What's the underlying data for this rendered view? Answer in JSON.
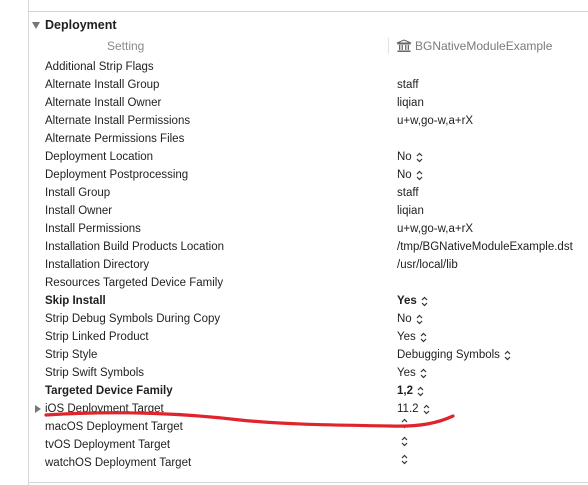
{
  "section": {
    "title": "Deployment"
  },
  "columns": {
    "setting": "Setting",
    "target": "BGNativeModuleExample"
  },
  "annotation": {
    "color": "#e0242c"
  },
  "rows": [
    {
      "name": "Additional Strip Flags",
      "value": "",
      "popup": false,
      "bold": false
    },
    {
      "name": "Alternate Install Group",
      "value": "staff",
      "popup": false,
      "bold": false
    },
    {
      "name": "Alternate Install Owner",
      "value": "liqian",
      "popup": false,
      "bold": false
    },
    {
      "name": "Alternate Install Permissions",
      "value": "u+w,go-w,a+rX",
      "popup": false,
      "bold": false
    },
    {
      "name": "Alternate Permissions Files",
      "value": "",
      "popup": false,
      "bold": false
    },
    {
      "name": "Deployment Location",
      "value": "No",
      "popup": true,
      "bold": false
    },
    {
      "name": "Deployment Postprocessing",
      "value": "No",
      "popup": true,
      "bold": false
    },
    {
      "name": "Install Group",
      "value": "staff",
      "popup": false,
      "bold": false
    },
    {
      "name": "Install Owner",
      "value": "liqian",
      "popup": false,
      "bold": false
    },
    {
      "name": "Install Permissions",
      "value": "u+w,go-w,a+rX",
      "popup": false,
      "bold": false
    },
    {
      "name": "Installation Build Products Location",
      "value": "/tmp/BGNativeModuleExample.dst",
      "popup": false,
      "bold": false
    },
    {
      "name": "Installation Directory",
      "value": "/usr/local/lib",
      "popup": false,
      "bold": false
    },
    {
      "name": "Resources Targeted Device Family",
      "value": "",
      "popup": false,
      "bold": false
    },
    {
      "name": "Skip Install",
      "value": "Yes",
      "popup": true,
      "bold": true
    },
    {
      "name": "Strip Debug Symbols During Copy",
      "value": "No",
      "popup": true,
      "bold": false
    },
    {
      "name": "Strip Linked Product",
      "value": "Yes",
      "popup": true,
      "bold": false
    },
    {
      "name": "Strip Style",
      "value": "Debugging Symbols",
      "popup": true,
      "bold": false
    },
    {
      "name": "Strip Swift Symbols",
      "value": "Yes",
      "popup": true,
      "bold": false
    },
    {
      "name": "Targeted Device Family",
      "value": "1,2",
      "popup": true,
      "bold": true
    },
    {
      "name": "iOS Deployment Target",
      "value": "11.2",
      "popup": true,
      "bold": false,
      "expandable": true
    },
    {
      "name": "macOS Deployment Target",
      "value": "",
      "popup": true,
      "bold": false
    },
    {
      "name": "tvOS Deployment Target",
      "value": "",
      "popup": true,
      "bold": false
    },
    {
      "name": "watchOS Deployment Target",
      "value": "",
      "popup": true,
      "bold": false
    }
  ]
}
